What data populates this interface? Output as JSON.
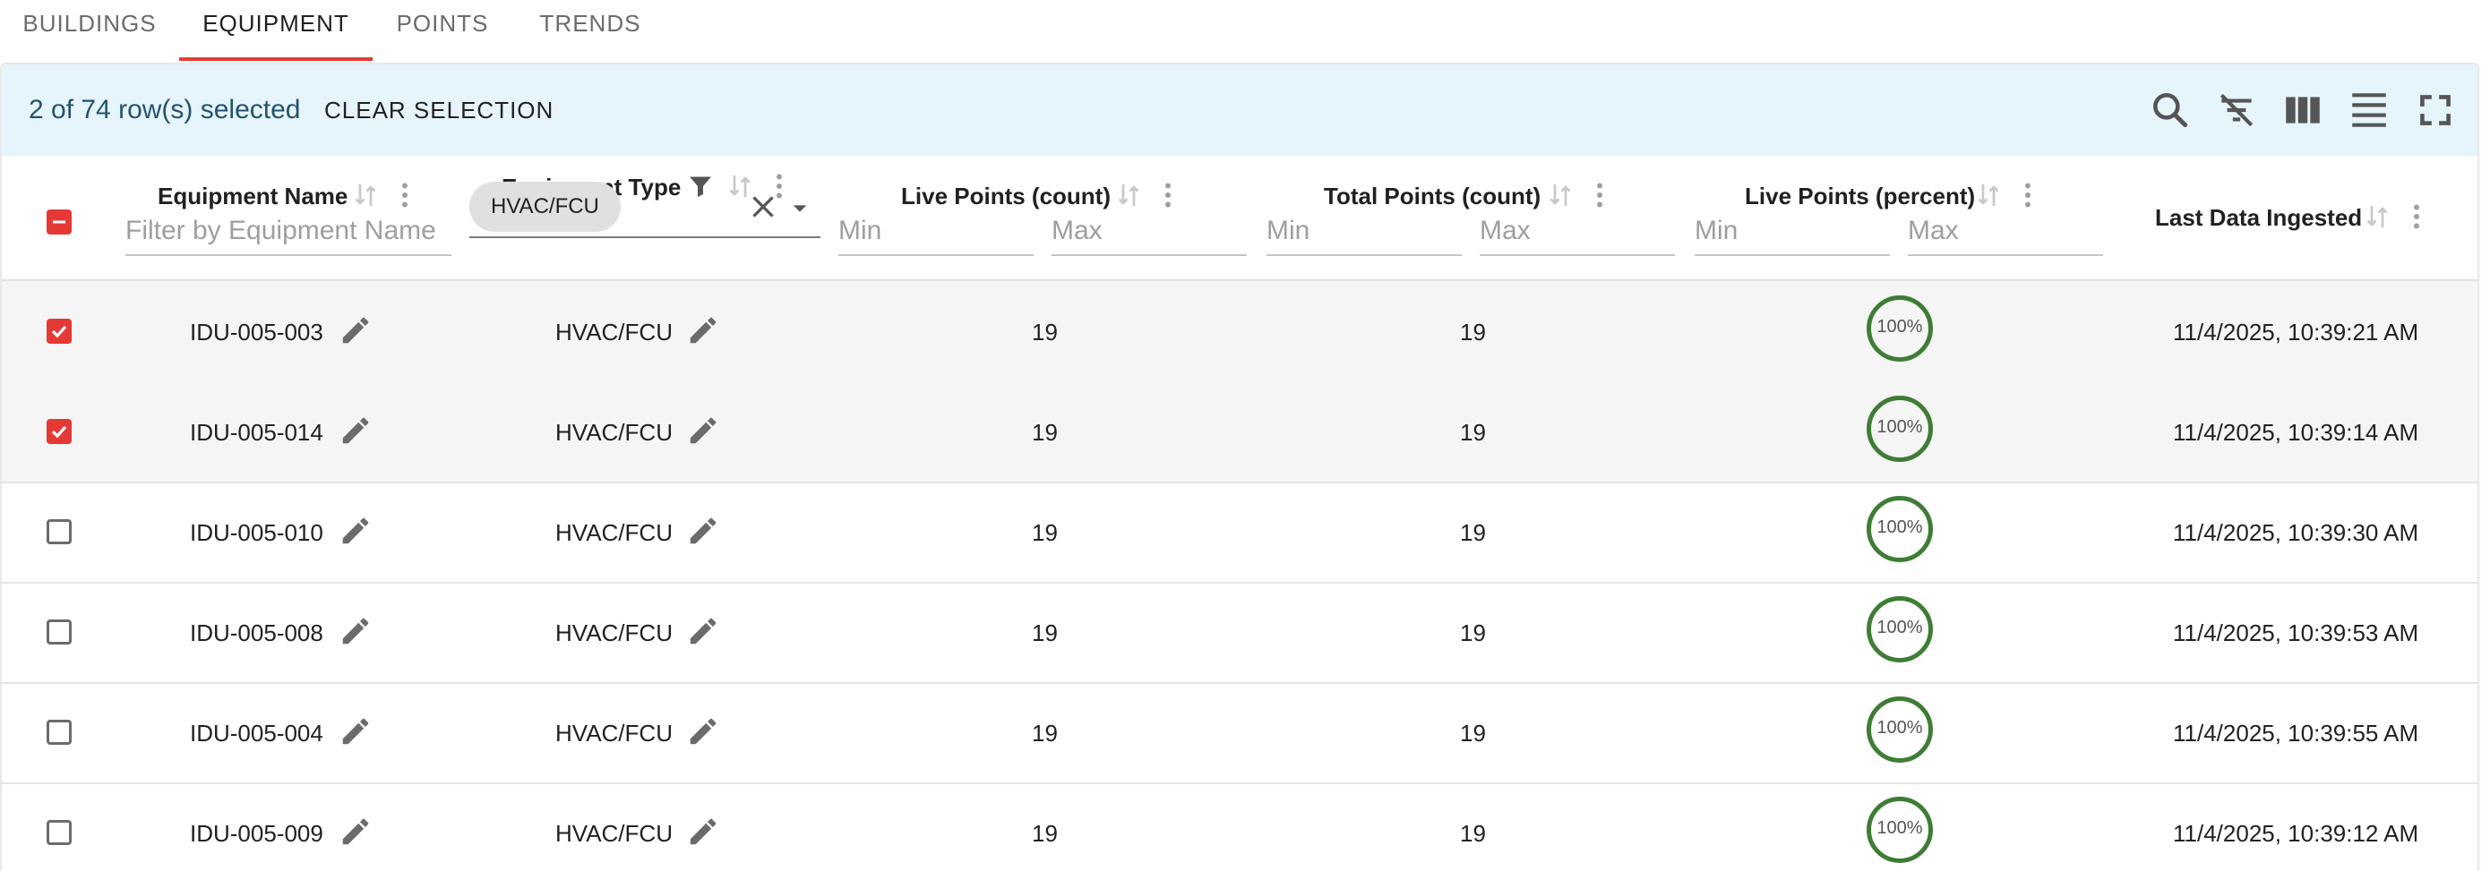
{
  "tabs": [
    {
      "label": "BUILDINGS"
    },
    {
      "label": "EQUIPMENT"
    },
    {
      "label": "POINTS"
    },
    {
      "label": "TRENDS"
    }
  ],
  "toolbar": {
    "selection_text": "2 of 74 row(s) selected",
    "clear_selection_label": "CLEAR SELECTION",
    "icons": [
      "search-icon",
      "clear-filter-icon",
      "columns-icon",
      "density-icon",
      "fullscreen-icon"
    ]
  },
  "columns": {
    "equipment_name": {
      "title": "Equipment Name",
      "filter_placeholder": "Filter by Equipment Name"
    },
    "equipment_type": {
      "title": "Equipment Type",
      "filter_value": "HVAC/FCU"
    },
    "live_points_count": {
      "title": "Live Points (count)",
      "min_placeholder": "Min",
      "max_placeholder": "Max"
    },
    "total_points_count": {
      "title": "Total Points (count)",
      "min_placeholder": "Min",
      "max_placeholder": "Max"
    },
    "live_points_percent": {
      "title": "Live Points (percent)",
      "min_placeholder": "Min",
      "max_placeholder": "Max"
    },
    "last_data_ingested": {
      "title": "Last Data Ingested"
    }
  },
  "rows": [
    {
      "name": "IDU-005-003",
      "type": "HVAC/FCU",
      "live": "19",
      "total": "19",
      "percent": "100%",
      "last": "11/4/2025, 10:39:21 AM",
      "selected": true
    },
    {
      "name": "IDU-005-014",
      "type": "HVAC/FCU",
      "live": "19",
      "total": "19",
      "percent": "100%",
      "last": "11/4/2025, 10:39:14 AM",
      "selected": true
    },
    {
      "name": "IDU-005-010",
      "type": "HVAC/FCU",
      "live": "19",
      "total": "19",
      "percent": "100%",
      "last": "11/4/2025, 10:39:30 AM",
      "selected": false
    },
    {
      "name": "IDU-005-008",
      "type": "HVAC/FCU",
      "live": "19",
      "total": "19",
      "percent": "100%",
      "last": "11/4/2025, 10:39:53 AM",
      "selected": false
    },
    {
      "name": "IDU-005-004",
      "type": "HVAC/FCU",
      "live": "19",
      "total": "19",
      "percent": "100%",
      "last": "11/4/2025, 10:39:55 AM",
      "selected": false
    },
    {
      "name": "IDU-005-009",
      "type": "HVAC/FCU",
      "live": "19",
      "total": "19",
      "percent": "100%",
      "last": "11/4/2025, 10:39:12 AM",
      "selected": false
    }
  ],
  "colors": {
    "accent": "#e53935",
    "toolbar_bg": "#e6f4fb",
    "percent_ring": "#3f7c36"
  }
}
